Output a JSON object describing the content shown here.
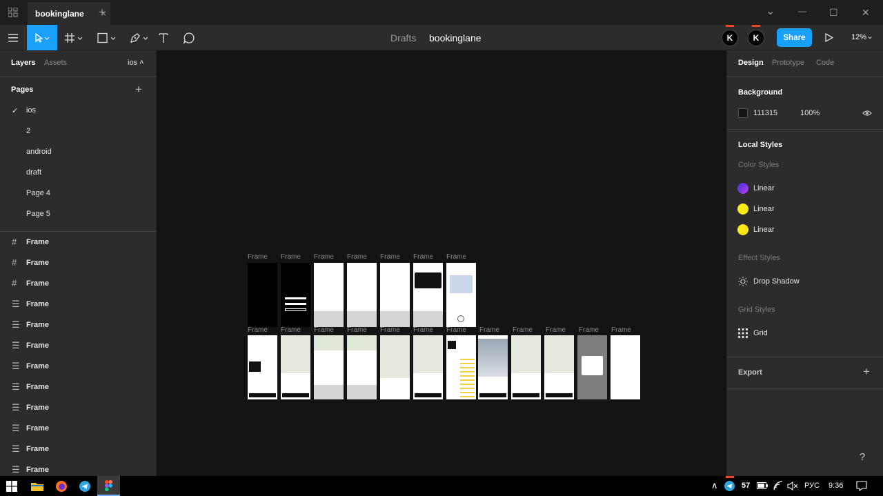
{
  "tabbar": {
    "file_tab_title": "bookinglane",
    "close_glyph": "×",
    "new_tab_glyph": "+",
    "minimize_glyph": "—",
    "maximize_glyph": "☐",
    "close_window_glyph": "✕",
    "chevron_glyph": "⌄"
  },
  "toolbar": {
    "breadcrumb_drafts": "Drafts",
    "breadcrumb_file": "bookinglane",
    "share_label": "Share",
    "zoom_label": "12%",
    "avatar_letter": "K",
    "accent_color": "#18a0fb"
  },
  "left_panel": {
    "tab_layers": "Layers",
    "tab_assets": "Assets",
    "current_page_label": "ios ˄",
    "pages_heading": "Pages",
    "add_glyph": "+",
    "check_glyph": "✓",
    "pages": [
      "ios",
      "2",
      "android",
      "draft",
      "Page 4",
      "Page 5"
    ],
    "layers": [
      "Frame",
      "Frame",
      "Frame",
      "Frame",
      "Frame",
      "Frame",
      "Frame",
      "Frame",
      "Frame",
      "Frame",
      "Frame",
      "Frame"
    ]
  },
  "canvas": {
    "background": "#111315",
    "frame_label": "Frame"
  },
  "right_panel": {
    "tab_design": "Design",
    "tab_prototype": "Prototype",
    "tab_code": "Code",
    "background_heading": "Background",
    "background_hex": "111315",
    "background_opacity": "100%",
    "local_styles_heading": "Local Styles",
    "color_styles_label": "Color Styles",
    "color_styles": [
      {
        "name": "Linear",
        "color": "#7b2ff7"
      },
      {
        "name": "Linear",
        "color": "#ffe81a"
      },
      {
        "name": "Linear",
        "color": "#ffe81a"
      }
    ],
    "effect_styles_label": "Effect Styles",
    "effect_style_name": "Drop Shadow",
    "grid_styles_label": "Grid Styles",
    "grid_style_name": "Grid",
    "export_heading": "Export",
    "export_add_glyph": "+"
  },
  "help_glyph": "?",
  "taskbar": {
    "telegram_badge": "57",
    "language": "РУС",
    "time": "9:36",
    "tray_chevron": "∧"
  }
}
